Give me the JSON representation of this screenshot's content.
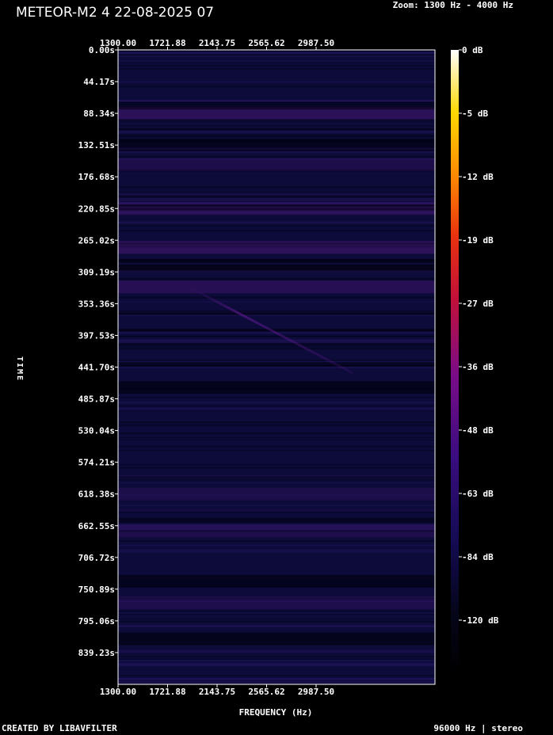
{
  "title": "METEOR-M2 4 22-08-2025 07",
  "zoom_label": "Zoom: 1300 Hz - 4000 Hz",
  "footer": {
    "left": "CREATED BY LIBAVFILTER",
    "right": "96000 Hz | stereo"
  },
  "chart_data": {
    "type": "heatmap",
    "title": "METEOR-M2 4 22-08-2025 07",
    "xlabel": "FREQUENCY (Hz)",
    "ylabel": "TIME",
    "x_ticks": [
      "1300.00",
      "1721.88",
      "2143.75",
      "2565.62",
      "2987.50"
    ],
    "x_tick_values": [
      1300.0,
      1721.88,
      2143.75,
      2565.62,
      2987.5
    ],
    "xlim": [
      1300,
      4000
    ],
    "y_ticks": [
      "0.00s",
      "44.17s",
      "88.34s",
      "132.51s",
      "176.68s",
      "220.85s",
      "265.02s",
      "309.19s",
      "353.36s",
      "397.53s",
      "441.70s",
      "485.87s",
      "530.04s",
      "574.21s",
      "618.38s",
      "662.55s",
      "706.72s",
      "750.89s",
      "795.06s",
      "839.23s"
    ],
    "y_tick_values": [
      0.0,
      44.17,
      88.34,
      132.51,
      176.68,
      220.85,
      265.02,
      309.19,
      353.36,
      397.53,
      441.7,
      485.87,
      530.04,
      574.21,
      618.38,
      662.55,
      706.72,
      750.89,
      795.06,
      839.23
    ],
    "ylim": [
      0,
      883.4
    ],
    "colorbar_ticks": [
      "0 dB",
      "-5 dB",
      "-12 dB",
      "-19 dB",
      "-27 dB",
      "-36 dB",
      "-48 dB",
      "-63 dB",
      "-84 dB",
      "-120 dB"
    ],
    "colors": {
      "background": "#000000",
      "low": "#000010",
      "mid_low": "#1a0a66",
      "mid": "#6a1090",
      "mid_high": "#e0101a",
      "high": "#ffd000",
      "max": "#ffffff"
    },
    "bands": [
      {
        "time": 88.34,
        "intensity": 0.32
      },
      {
        "time": 132.51,
        "intensity": 0.05
      },
      {
        "time": 160.0,
        "intensity": 0.18
      },
      {
        "time": 220.85,
        "intensity": 0.3
      },
      {
        "time": 275.0,
        "intensity": 0.34
      },
      {
        "time": 300.0,
        "intensity": 0.12
      },
      {
        "time": 330.0,
        "intensity": 0.28
      },
      {
        "time": 470.0,
        "intensity": 0.06
      },
      {
        "time": 618.38,
        "intensity": 0.16
      },
      {
        "time": 670.0,
        "intensity": 0.2
      },
      {
        "time": 740.0,
        "intensity": 0.08
      },
      {
        "time": 770.0,
        "intensity": 0.2
      },
      {
        "time": 820.0,
        "intensity": 0.12
      }
    ],
    "trace": [
      {
        "freq": 1900,
        "time": 330
      },
      {
        "freq": 2600,
        "time": 390
      },
      {
        "freq": 3300,
        "time": 450
      }
    ]
  }
}
